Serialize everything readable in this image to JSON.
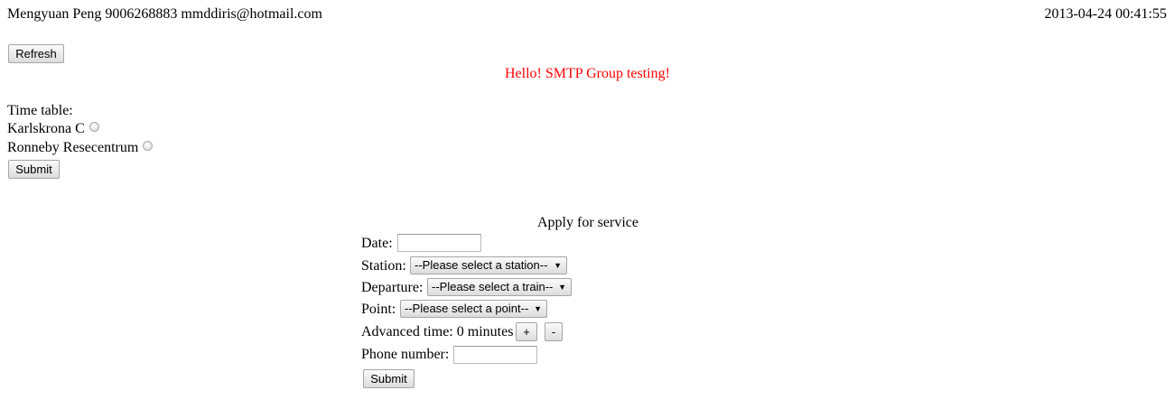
{
  "header": {
    "user_info": "Mengyuan Peng 9006268883 mmddiris@hotmail.com",
    "timestamp": "2013-04-24 00:41:55"
  },
  "refresh_label": "Refresh",
  "greeting": "Hello! SMTP Group testing!",
  "timetable": {
    "title": "Time table:",
    "options": [
      {
        "label": "Karlskrona C"
      },
      {
        "label": "Ronneby Resecentrum"
      }
    ],
    "submit_label": "Submit"
  },
  "service": {
    "title": "Apply for service",
    "date_label": "Date:",
    "date_value": "",
    "station_label": "Station:",
    "station_selected": "--Please select a station--",
    "departure_label": "Departure:",
    "departure_selected": "--Please select a train--",
    "point_label": "Point:",
    "point_selected": "--Please select a point--",
    "advanced_label": "Advanced time:",
    "advanced_value": "0 minutes",
    "plus_label": "+",
    "minus_label": "-",
    "phone_label": "Phone number:",
    "phone_value": "",
    "submit_label": "Submit"
  },
  "colors": {
    "greeting": "#ff0000"
  },
  "icons": {
    "select_arrow": "dropdown-arrow-icon",
    "radio": "radio-button"
  }
}
